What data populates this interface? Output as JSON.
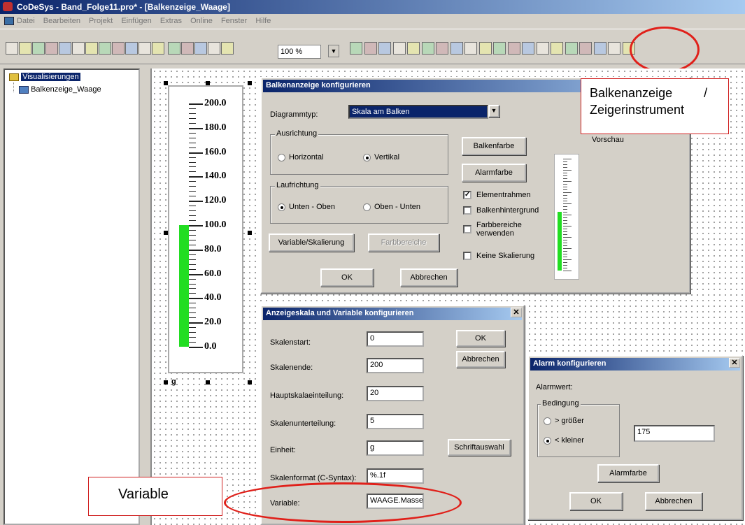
{
  "window": {
    "title": "CoDeSys - Band_Folge11.pro* - [Balkenzeige_Waage]"
  },
  "menu": [
    "Datei",
    "Bearbeiten",
    "Projekt",
    "Einfügen",
    "Extras",
    "Online",
    "Fenster",
    "Hilfe"
  ],
  "toolbar": {
    "zoom": "100 %"
  },
  "tree": {
    "root": "Visualisierungen",
    "child": "Balkenzeige_Waage"
  },
  "scale": {
    "labels": [
      "200.0",
      "180.0",
      "160.0",
      "140.0",
      "120.0",
      "100.0",
      "80.0",
      "60.0",
      "40.0",
      "20.0",
      "0.0"
    ],
    "unit": "g",
    "bar_value": 100,
    "max": 200,
    "bar_color": "#22dd22"
  },
  "bar_dialog": {
    "title": "Balkenanzeige konfigurieren",
    "diagram_label": "Diagrammtyp:",
    "diagram_value": "Skala am Balken",
    "orientation_group": "Ausrichtung",
    "horizontal": "Horizontal",
    "vertical": "Vertikal",
    "direction_group": "Laufrichtung",
    "bottom_top": "Unten - Oben",
    "top_bottom": "Oben - Unten",
    "bar_color_btn": "Balkenfarbe",
    "alarm_color_btn": "Alarmfarbe",
    "frame": "Elementrahmen",
    "background": "Balkenhintergrund",
    "color_ranges": "Farbbereiche verwenden",
    "no_scale": "Keine Skalierung",
    "variable_btn": "Variable/Skalierung",
    "colorranges_btn": "Farbbereiche",
    "ok": "OK",
    "cancel": "Abbrechen",
    "preview": "Vorschau"
  },
  "scale_dialog": {
    "title": "Anzeigeskala und Variable konfigurieren",
    "start_label": "Skalenstart:",
    "start_value": "0",
    "end_label": "Skalenende:",
    "end_value": "200",
    "main_label": "Hauptskalaeinteilung:",
    "main_value": "20",
    "sub_label": "Skalenunterteilung:",
    "sub_value": "5",
    "unit_label": "Einheit:",
    "unit_value": "g",
    "format_label": "Skalenformat (C-Syntax):",
    "format_value": "%.1f",
    "variable_label": "Variable:",
    "variable_value": "WAAGE.Masse",
    "ok": "OK",
    "cancel": "Abbrechen",
    "font_btn": "Schriftauswahl"
  },
  "alarm_dialog": {
    "title": "Alarm konfigurieren",
    "value_label": "Alarmwert:",
    "condition_group": "Bedingung",
    "greater": "> größer",
    "smaller": "< kleiner",
    "value": "175",
    "alarm_color_btn": "Alarmfarbe",
    "ok": "OK",
    "cancel": "Abbrechen"
  },
  "callouts": {
    "top": "Balkenanzeige         /\nZeigerinstrument",
    "variable": "Variable"
  }
}
